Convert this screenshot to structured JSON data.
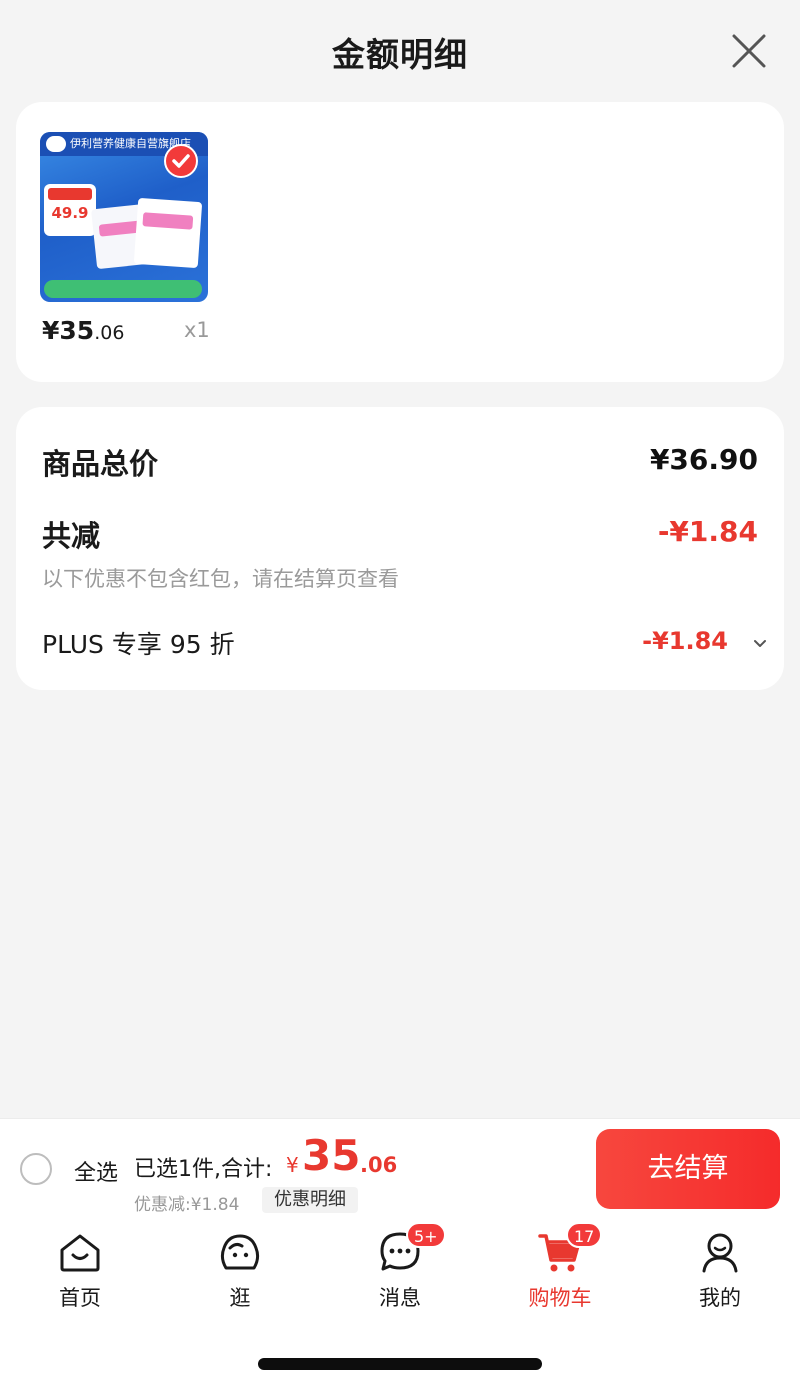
{
  "header": {
    "title": "金额明细"
  },
  "product": {
    "store_name": "伊利营养健康自营旗舰店",
    "thumb_price": "49.9",
    "price_symbol": "¥",
    "price_int": "35",
    "price_dec": ".06",
    "quantity": "x1"
  },
  "breakdown": {
    "total_label": "商品总价",
    "total_value": "¥36.90",
    "reduce_label": "共减",
    "reduce_value": "-¥1.84",
    "reduce_note": "以下优惠不包含红包，请在结算页查看",
    "plus_label": "PLUS 专享 95 折",
    "plus_value": "-¥1.84"
  },
  "checkout": {
    "select_all_label": "全选",
    "selected_summary": "已选1件,合计:",
    "total_symbol": "¥",
    "total_int": "35",
    "total_dec": ".06",
    "discount_text": "优惠减:¥1.84",
    "discount_detail_label": "优惠明细",
    "checkout_label": "去结算"
  },
  "tabs": [
    {
      "label": "首页",
      "icon": "home-icon",
      "badge": ""
    },
    {
      "label": "逛",
      "icon": "explore-icon",
      "badge": ""
    },
    {
      "label": "消息",
      "icon": "message-icon",
      "badge": "5+"
    },
    {
      "label": "购物车",
      "icon": "cart-icon",
      "badge": "17",
      "active": true
    },
    {
      "label": "我的",
      "icon": "profile-icon",
      "badge": ""
    }
  ],
  "colors": {
    "accent": "#e8382f",
    "background": "#f4f4f4",
    "card": "#ffffff",
    "muted_text": "#9a9a9a"
  }
}
